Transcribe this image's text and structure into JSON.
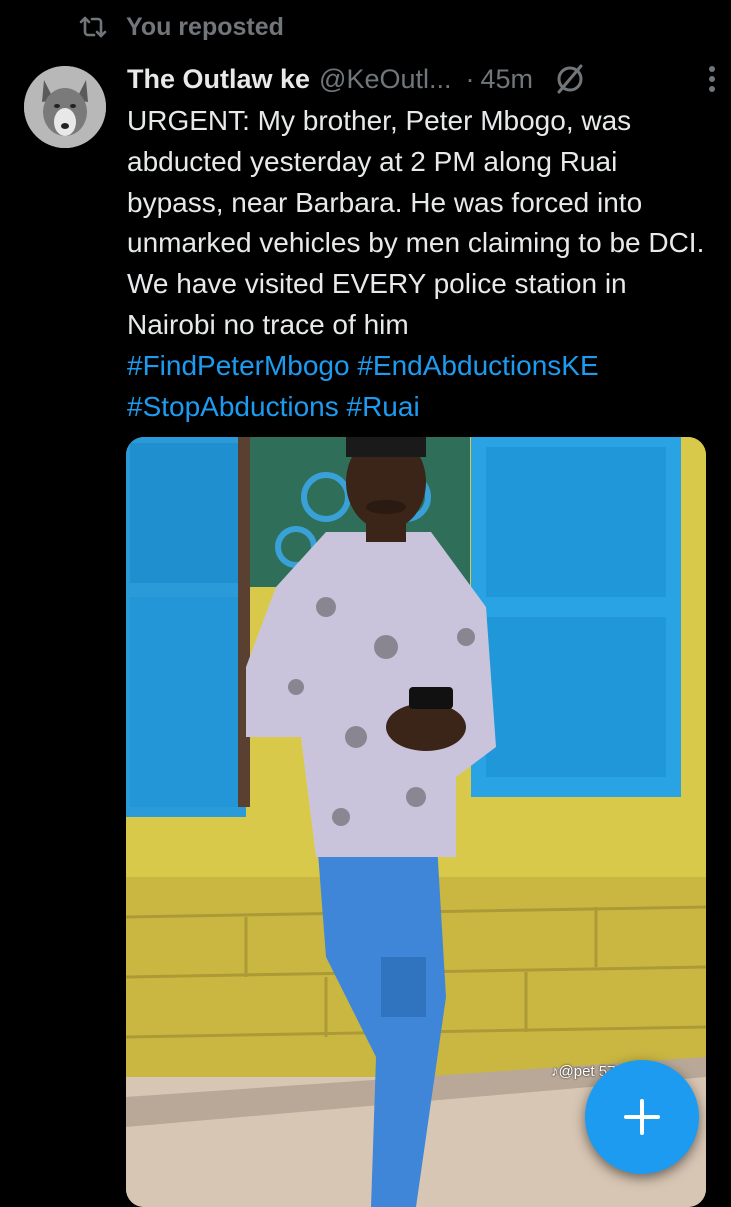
{
  "repost": {
    "label": "You reposted",
    "icon": "repost-icon"
  },
  "post": {
    "author_name": "The Outlaw ke",
    "handle": "@KeOutl...",
    "separator": "·",
    "time": "45m",
    "body": "URGENT: My brother, Peter Mbogo, was abducted yesterday at 2 PM along Ruai bypass, near Barbara. He was forced into unmarked vehicles by men claiming to be DCI. We have visited EVERY police station in Nairobi no trace of him",
    "hashtags": [
      "#FindPeterMbogo",
      "#EndAbductionsKE",
      "#StopAbductions",
      "#Ruai"
    ],
    "media": {
      "watermark": "♪@pet     57"
    }
  },
  "fab": {
    "icon": "plus-icon"
  },
  "colors": {
    "accent": "#1d9bf0",
    "muted": "#71767b",
    "text": "#e7e9ea",
    "background": "#000000"
  }
}
